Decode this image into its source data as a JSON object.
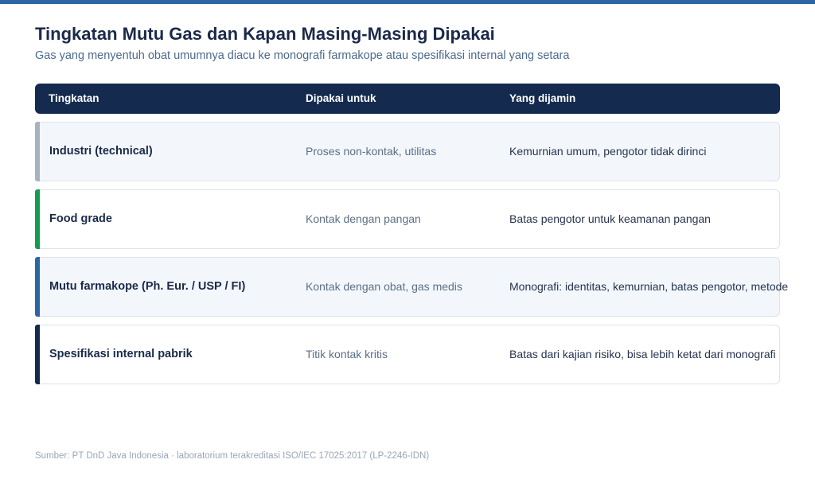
{
  "header": {
    "title": "Tingkatan Mutu Gas dan Kapan Masing-Masing Dipakai",
    "subtitle": "Gas yang menyentuh obat umumnya diacu ke monografi farmakope atau spesifikasi internal yang setara"
  },
  "table": {
    "columns": [
      "Tingkatan",
      "Dipakai untuk",
      "Yang dijamin"
    ],
    "rows": [
      {
        "level": "Industri (technical)",
        "use": "Proses non-kontak, utilitas",
        "guarantee": "Kemurnian umum, pengotor tidak dirinci",
        "accent_color": "#a7b2c1",
        "shaded": true
      },
      {
        "level": "Food grade",
        "use": "Kontak dengan pangan",
        "guarantee": "Batas pengotor untuk keamanan pangan",
        "accent_color": "#159a52",
        "shaded": false
      },
      {
        "level": "Mutu farmakope (Ph. Eur. / USP / FI)",
        "use": "Kontak dengan obat, gas medis",
        "guarantee": "Monografi: identitas, kemurnian, batas pengotor, metode",
        "accent_color": "#2b67a5",
        "shaded": true
      },
      {
        "level": "Spesifikasi internal pabrik",
        "use": "Titik kontak kritis",
        "guarantee": "Batas dari kajian risiko, bisa lebih ketat dari monografi",
        "accent_color": "#142b4f",
        "shaded": false
      }
    ]
  },
  "footer": {
    "source": "Sumber: PT DnD Java Indonesia · laboratorium terakreditasi ISO/IEC 17025:2017 (LP-2246-IDN)"
  },
  "colors": {
    "accent_bar": "#2b67a5",
    "header_bg": "#142b4f",
    "title": "#1b2a4a"
  }
}
